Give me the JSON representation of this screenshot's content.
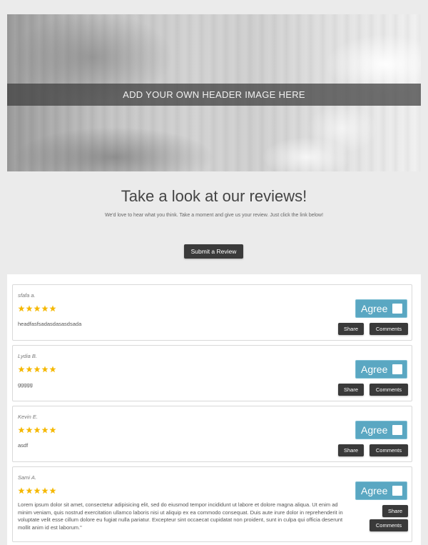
{
  "header": {
    "image_caption": "ADD YOUR OWN HEADER IMAGE HERE"
  },
  "intro": {
    "title": "Take a look at our reviews!",
    "subtitle": "We'd love to hear what you think. Take a moment and give us your review. Just click the link below!",
    "submit_label": "Submit a Review"
  },
  "colors": {
    "agree_button": "#5aa7c2",
    "star": "#f5b800",
    "dark_button": "#3a3a3a"
  },
  "reviews": [
    {
      "name": "sfafa a.",
      "rating": 5,
      "text": "headfasfsadasdasasdsada",
      "agree_label": "Agree",
      "share_label": "Share",
      "comments_label": "Comments"
    },
    {
      "name": "Lydia B.",
      "rating": 5,
      "text": "ggggg",
      "agree_label": "Agree",
      "share_label": "Share",
      "comments_label": "Comments"
    },
    {
      "name": "Kevin E.",
      "rating": 5,
      "text": "asdf",
      "agree_label": "Agree",
      "share_label": "Share",
      "comments_label": "Comments"
    },
    {
      "name": "Sami A.",
      "rating": 5,
      "text": "Lorem ipsum dolor sit amet, consectetur adipisicing elit, sed do eiusmod tempor incididunt ut labore et dolore magna aliqua. Ut enim ad minim veniam, quis nostrud exercitation ullamco laboris nisi ut aliquip ex ea commodo consequat. Duis aute irure dolor in reprehenderit in voluptate velit esse cillum dolore eu fugiat nulla pariatur. Excepteur sint occaecat cupidatat non proident, sunt in culpa qui officia deserunt mollit anim id est laborum.\"",
      "agree_label": "Agree",
      "share_label": "Share",
      "comments_label": "Comments"
    }
  ]
}
